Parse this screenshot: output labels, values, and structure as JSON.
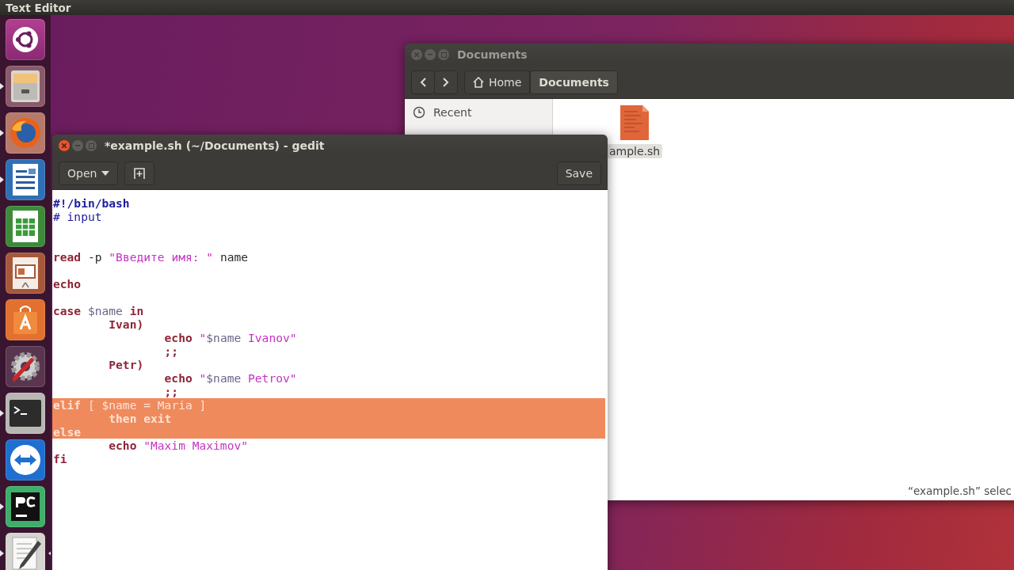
{
  "top_bar": {
    "title": "Text Editor"
  },
  "launcher": [
    {
      "kind": "ubuntu",
      "running": false,
      "selected": false
    },
    {
      "kind": "files",
      "running": true,
      "selected": false
    },
    {
      "kind": "firefox",
      "running": true,
      "selected": false
    },
    {
      "kind": "writer",
      "running": true,
      "selected": false
    },
    {
      "kind": "calc",
      "running": false,
      "selected": false
    },
    {
      "kind": "impress",
      "running": false,
      "selected": false
    },
    {
      "kind": "store",
      "running": false,
      "selected": false
    },
    {
      "kind": "settings",
      "running": false,
      "selected": false
    },
    {
      "kind": "terminal",
      "running": true,
      "selected": false
    },
    {
      "kind": "teamviewer",
      "running": false,
      "selected": false
    },
    {
      "kind": "pycharm",
      "running": true,
      "selected": false
    },
    {
      "kind": "editor",
      "running": true,
      "selected": true
    }
  ],
  "file_manager": {
    "title": "Documents",
    "path": [
      {
        "label": "Home",
        "kind": "home",
        "selected": false
      },
      {
        "label": "Documents",
        "kind": "folder",
        "selected": true
      }
    ],
    "sidebar": [
      {
        "label": "Recent"
      }
    ],
    "files": [
      {
        "name": "ample.sh",
        "selected": true
      }
    ],
    "status": "“example.sh” selec"
  },
  "editor": {
    "title": "*example.sh (~/Documents) - gedit",
    "open_button": "Open",
    "save_button": "Save",
    "lines": [
      {
        "selected": false,
        "tokens": [
          {
            "text": "#!/bin/bash",
            "kind": "shebang"
          }
        ]
      },
      {
        "selected": false,
        "tokens": [
          {
            "text": "# input",
            "kind": "comment"
          }
        ]
      },
      {
        "selected": false
      },
      {
        "selected": false
      },
      {
        "selected": false,
        "tokens": [
          {
            "text": "read",
            "kind": "keyword"
          },
          {
            "text": " -p ",
            "kind": "plain"
          },
          {
            "text": "\"Введите имя: \"",
            "kind": "string"
          },
          {
            "text": " name",
            "kind": "plain"
          }
        ]
      },
      {
        "selected": false
      },
      {
        "selected": false,
        "tokens": [
          {
            "text": "echo",
            "kind": "keyword"
          }
        ]
      },
      {
        "selected": false
      },
      {
        "selected": false,
        "tokens": [
          {
            "text": "case",
            "kind": "keyword"
          },
          {
            "text": " $name ",
            "kind": "variable"
          },
          {
            "text": "in",
            "kind": "keyword"
          }
        ]
      },
      {
        "selected": false,
        "tokens": [
          {
            "text": "        Ivan)",
            "kind": "keyword"
          }
        ]
      },
      {
        "selected": false,
        "tokens": [
          {
            "text": "                echo",
            "kind": "keyword"
          },
          {
            "text": " \"",
            "kind": "string"
          },
          {
            "text": "$name",
            "kind": "variable"
          },
          {
            "text": " Ivanov\"",
            "kind": "string"
          }
        ]
      },
      {
        "selected": false,
        "tokens": [
          {
            "text": "                ;;",
            "kind": "keyword"
          }
        ]
      },
      {
        "selected": false,
        "tokens": [
          {
            "text": "        Petr)",
            "kind": "keyword"
          }
        ]
      },
      {
        "selected": false,
        "tokens": [
          {
            "text": "                echo",
            "kind": "keyword"
          },
          {
            "text": " \"",
            "kind": "string"
          },
          {
            "text": "$name",
            "kind": "variable"
          },
          {
            "text": " Petrov\"",
            "kind": "string"
          }
        ]
      },
      {
        "selected": false,
        "tokens": [
          {
            "text": "                ;;",
            "kind": "keyword"
          }
        ]
      },
      {
        "selected": true,
        "tokens": [
          {
            "text": "elif",
            "kind": "keyword"
          },
          {
            "text": " [ $name = Maria ]",
            "kind": "plain"
          }
        ]
      },
      {
        "selected": true,
        "tokens": [
          {
            "text": "        then exit",
            "kind": "keyword"
          }
        ]
      },
      {
        "selected": true,
        "tokens": [
          {
            "text": "else",
            "kind": "keyword"
          }
        ]
      },
      {
        "selected": false,
        "tokens": [
          {
            "text": "        echo",
            "kind": "keyword"
          },
          {
            "text": " \"Maxim Maximov\"",
            "kind": "string"
          }
        ]
      },
      {
        "selected": false,
        "tokens": [
          {
            "text": "fi",
            "kind": "keyword"
          }
        ]
      }
    ]
  }
}
